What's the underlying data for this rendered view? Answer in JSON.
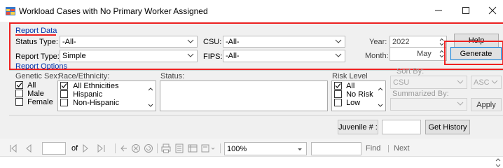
{
  "window": {
    "title": "Workload Cases with No Primary Worker Assigned",
    "minimize_icon": "minimize-icon",
    "maximize_icon": "maximize-icon",
    "close_icon": "close-icon"
  },
  "report_data": {
    "group_label": "Report Data",
    "status_type_label": "Status Type:",
    "status_type_value": "-All-",
    "csu_label": "CSU:",
    "csu_value": "-All-",
    "year_label": "Year:",
    "year_value": "2022",
    "help_label": "Help",
    "report_type_label": "Report Type:",
    "report_type_value": "Simple",
    "fips_label": "FIPS:",
    "fips_value": "-All-",
    "month_label": "Month:",
    "month_value": "May",
    "generate_label": "Generate"
  },
  "report_options": {
    "group_label": "Report Options",
    "genetic_sex_label": "Genetic Sex:",
    "genetic_sex_options": [
      {
        "label": "All",
        "checked": true
      },
      {
        "label": "Male",
        "checked": false
      },
      {
        "label": "Female",
        "checked": false
      }
    ],
    "race_label": "Race/Ethnicity:",
    "race_options": [
      {
        "label": "All Ethnicities",
        "checked": true
      },
      {
        "label": "Hispanic",
        "checked": false
      },
      {
        "label": "Non-Hispanic",
        "checked": false
      }
    ],
    "status_label": "Status:",
    "risk_label": "Risk Level",
    "risk_options": [
      {
        "label": "All",
        "checked": true
      },
      {
        "label": "No Risk",
        "checked": false
      },
      {
        "label": "Low",
        "checked": false
      }
    ],
    "sort_by_label": "Sort By:",
    "sort_by_value": "CSU",
    "sort_dir_value": "ASC",
    "summarized_by_label": "Summarized By:",
    "summarized_by_value": "",
    "apply_label": "Apply"
  },
  "juvenile": {
    "label": "Juvenile # :",
    "value": "",
    "get_history_label": "Get History"
  },
  "viewer": {
    "page_value": "",
    "of_label": "of",
    "zoom_value": "100%",
    "find_value": "",
    "find_label": "Find",
    "next_label": "Next",
    "separator": "|"
  },
  "colors": {
    "highlight": "#e22222",
    "group_label": "#0033aa",
    "focus": "#0078d7"
  }
}
